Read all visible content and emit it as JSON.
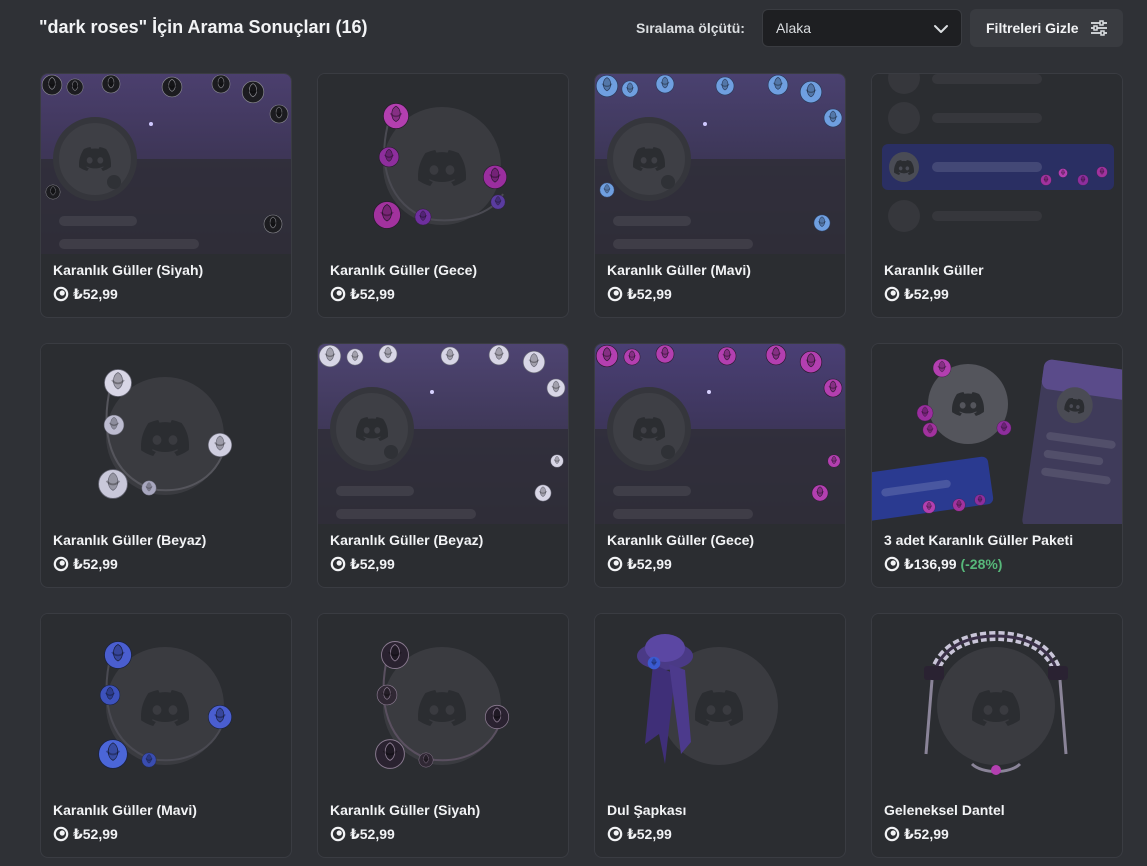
{
  "header": {
    "title": "\"dark roses\" İçin Arama Sonuçları (16)",
    "sort_label": "Sıralama ölçütü:",
    "sort_value": "Alaka",
    "filter_button": "Filtreleri Gizle"
  },
  "colors": {
    "background": "#2f3136",
    "card": "#2b2d31",
    "discount": "#57b87a"
  },
  "icons": {
    "currency": "orb-icon",
    "dropdown": "chevron-down-icon",
    "filter": "sliders-icon"
  },
  "items": [
    {
      "name": "Karanlık Güller (Siyah)",
      "price": "₺52,99",
      "discount": ""
    },
    {
      "name": "Karanlık Güller (Gece)",
      "price": "₺52,99",
      "discount": ""
    },
    {
      "name": "Karanlık Güller (Mavi)",
      "price": "₺52,99",
      "discount": ""
    },
    {
      "name": "Karanlık Güller",
      "price": "₺52,99",
      "discount": ""
    },
    {
      "name": "Karanlık Güller (Beyaz)",
      "price": "₺52,99",
      "discount": ""
    },
    {
      "name": "Karanlık Güller (Beyaz)",
      "price": "₺52,99",
      "discount": ""
    },
    {
      "name": "Karanlık Güller (Gece)",
      "price": "₺52,99",
      "discount": ""
    },
    {
      "name": "3 adet Karanlık Güller Paketi",
      "price": "₺136,99",
      "discount": "(-28%)"
    },
    {
      "name": "Karanlık Güller (Mavi)",
      "price": "₺52,99",
      "discount": ""
    },
    {
      "name": "Karanlık Güller (Siyah)",
      "price": "₺52,99",
      "discount": ""
    },
    {
      "name": "Dul Şapkası",
      "price": "₺52,99",
      "discount": ""
    },
    {
      "name": "Geleneksel Dantel",
      "price": "₺52,99",
      "discount": ""
    }
  ]
}
